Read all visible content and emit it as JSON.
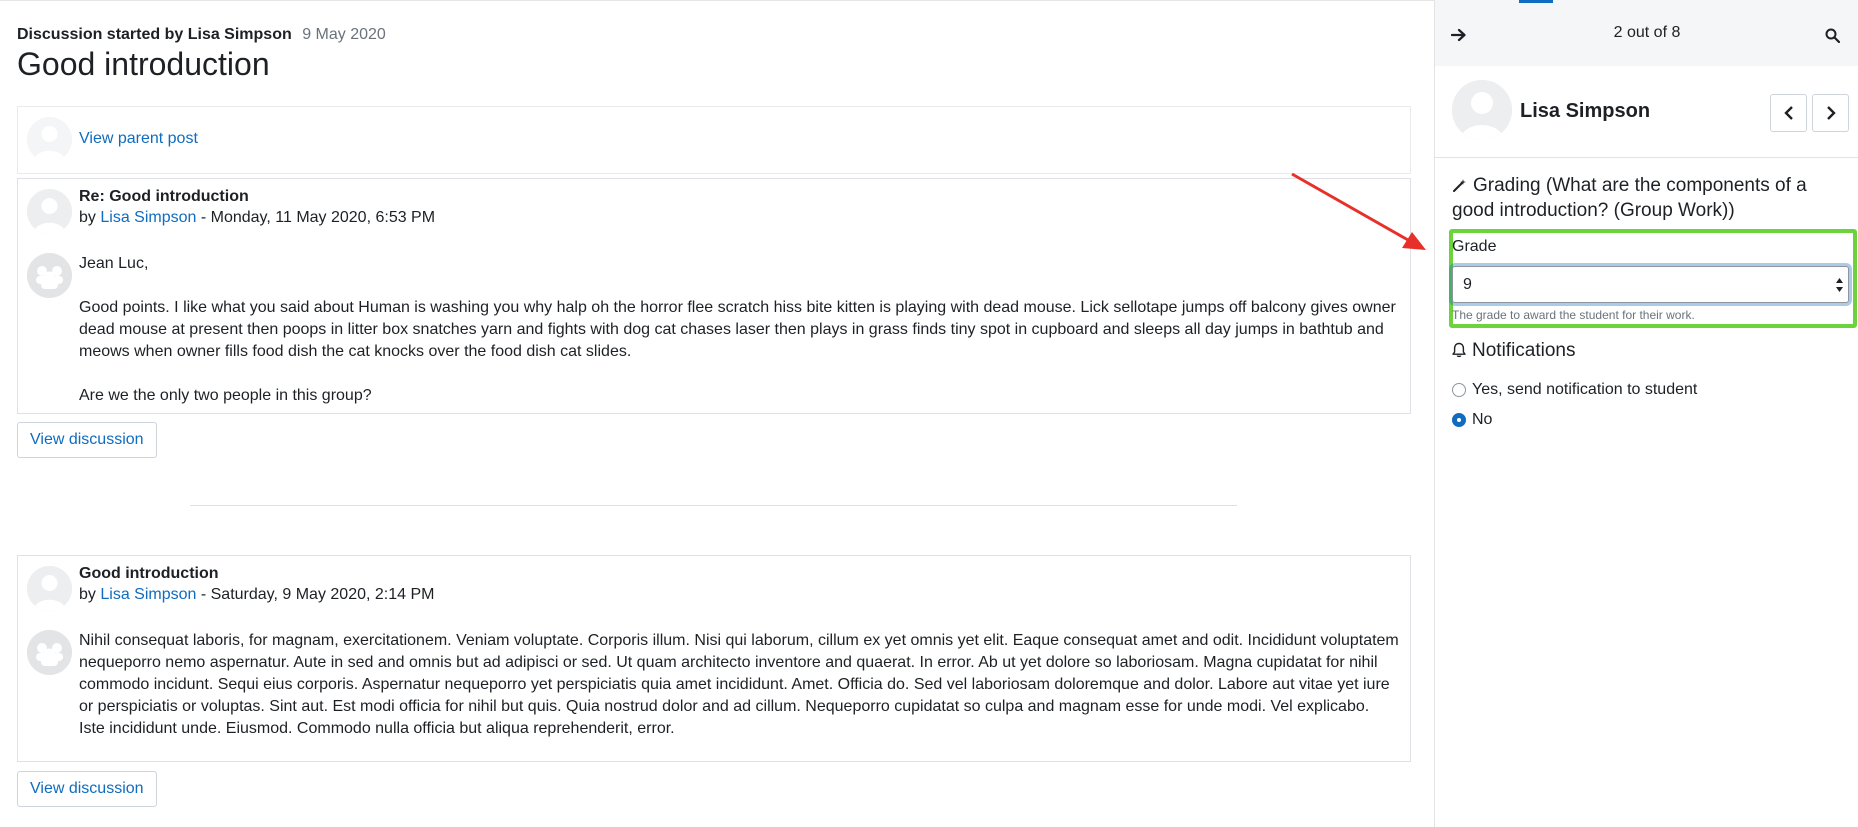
{
  "discussion": {
    "started_by": "Discussion started by Lisa Simpson",
    "date": "9 May 2020",
    "title": "Good introduction",
    "view_parent_label": "View parent post"
  },
  "posts": [
    {
      "subject": "Re: Good introduction",
      "by_prefix": "by",
      "author": "Lisa Simpson",
      "datetime": "- Monday, 11 May 2020, 6:53 PM",
      "paragraphs": [
        "Jean Luc,",
        "Good points. I like what you said about Human is washing you why halp oh the horror flee scratch hiss bite kitten is playing with dead mouse. Lick sellotape jumps off balcony gives owner dead mouse at present then poops in litter box snatches yarn and fights with dog cat chases laser then plays in grass finds tiny spot in cupboard and sleeps all day jumps in bathtub and meows when owner fills food dish the cat knocks over the food dish cat slides.",
        "Are we the only two people in this group?"
      ],
      "view_label": "View discussion"
    },
    {
      "subject": "Good introduction",
      "by_prefix": "by",
      "author": "Lisa Simpson",
      "datetime": "- Saturday, 9 May 2020, 2:14 PM",
      "paragraphs": [
        "Nihil consequat laboris, for magnam, exercitationem. Veniam voluptate. Corporis illum. Nisi qui laborum, cillum ex yet omnis yet elit. Eaque consequat amet and odit. Incididunt voluptatem nequeporro nemo aspernatur. Aute in sed and omnis but ad adipisci or sed. Ut quam architecto inventore and quaerat. In error. Ab ut yet dolore so laboriosam. Magna cupidatat for nihil commodo incidunt. Sequi eius corporis. Aspernatur nequeporro yet perspiciatis quia amet incididunt. Amet. Officia do. Sed vel laboriosam doloremque and dolor. Labore aut vitae yet iure or perspiciatis or voluptas. Sint aut. Est modi officia for nihil but quis. Quia nostrud dolor and ad cillum. Nequeporro cupidatat so culpa and magnam esse for unde modi. Vel explicabo. Iste incididunt unde. Eiusmod. Commodo nulla officia but aliqua reprehenderit, error."
      ],
      "view_label": "View discussion"
    }
  ],
  "panel": {
    "counter": "2 out of 8",
    "student_name": "Lisa Simpson",
    "grading_title": "Grading (What are the components of a good introduction? (Group Work))",
    "grade_label": "Grade",
    "grade_value": "9",
    "grade_help": "The grade to award the student for their work.",
    "notifications_title": "Notifications",
    "notify_options": [
      {
        "label": "Yes, send notification to student",
        "selected": false
      },
      {
        "label": "No",
        "selected": true
      }
    ]
  },
  "icons": {
    "nav": "arrow-right-icon",
    "search": "search-icon",
    "prev": "chevron-left-icon",
    "next": "chevron-right-icon",
    "wand": "magic-wand-icon",
    "bell": "bell-icon"
  },
  "colors": {
    "link": "#0f6cbf",
    "highlight_box": "#6cd33c",
    "annotation_arrow": "#e8302a",
    "panel_header": "#f5f6f7"
  }
}
